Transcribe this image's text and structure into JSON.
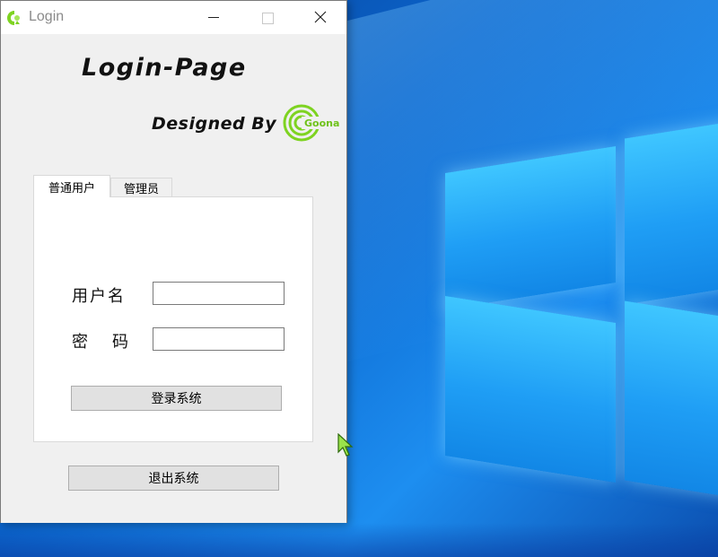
{
  "window": {
    "title": "Login",
    "heading": "Login-Page",
    "designed_by": "Designed By",
    "brand_logo_text": "Goona"
  },
  "tabs": [
    {
      "label": "普通用户",
      "active": true
    },
    {
      "label": "管理员",
      "active": false
    }
  ],
  "form": {
    "username_label": "用户名",
    "username_value": "",
    "password_label": "密码",
    "password_value": "",
    "login_button": "登录系统"
  },
  "exit_button": "退出系统",
  "colors": {
    "accent_green": "#7ed321",
    "window_bg": "#f0f0f0",
    "button_bg": "#e1e1e1",
    "desktop_blue": "#0a64cc"
  }
}
